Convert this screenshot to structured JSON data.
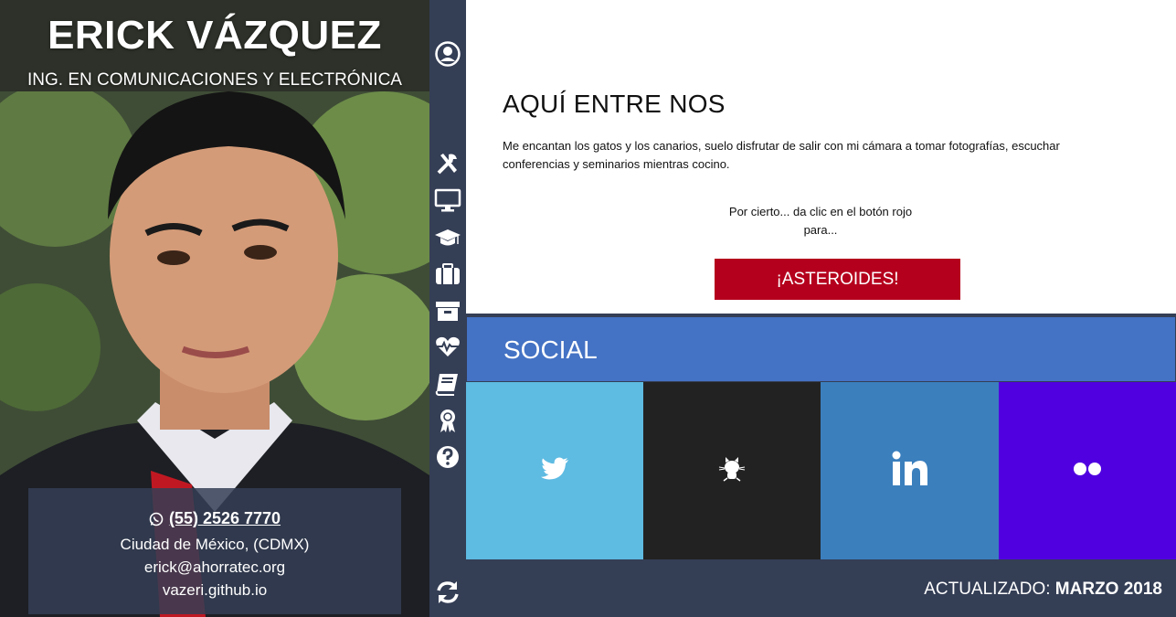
{
  "profile": {
    "name": "ERICK VÁZQUEZ",
    "subtitle": "ING. EN COMUNICACIONES Y ELECTRÓNICA",
    "contact": {
      "phone": "(55) 2526 7770",
      "city": "Ciudad de México, (CDMX)",
      "email": "erick@ahorratec.org",
      "website": "vazeri.github.io"
    }
  },
  "nav": {
    "icons": [
      "user-circle-icon",
      "tools-icon",
      "monitor-icon",
      "graduation-cap-icon",
      "briefcase-icon",
      "archive-icon",
      "heartbeat-icon",
      "book-icon",
      "award-icon",
      "question-icon",
      "refresh-icon"
    ]
  },
  "about": {
    "title": "AQUÍ ENTRE NOS",
    "bio": "Me encantan los gatos y los canarios, suelo disfrutar de salir con mi cámara a tomar fotografías, escuchar conferencias y seminarios mientras cocino.",
    "hint_line1": "Por cierto... da clic en el botón rojo",
    "hint_line2": "para...",
    "button": "¡ASTEROIDES!"
  },
  "social": {
    "title": "SOCIAL",
    "tiles": [
      {
        "name": "twitter",
        "icon": "twitter-icon",
        "color": "#5ebbe2"
      },
      {
        "name": "github",
        "icon": "github-icon",
        "color": "#222222"
      },
      {
        "name": "linkedin",
        "icon": "linkedin-icon",
        "color": "#3b7fbd"
      },
      {
        "name": "flickr",
        "icon": "flickr-icon",
        "color": "#5000e0"
      }
    ]
  },
  "footer": {
    "label": "ACTUALIZADO:",
    "date": "MARZO 2018"
  },
  "colors": {
    "nav_bg": "#343e55",
    "accent_red": "#b5001d",
    "social_header": "#4472c4"
  }
}
